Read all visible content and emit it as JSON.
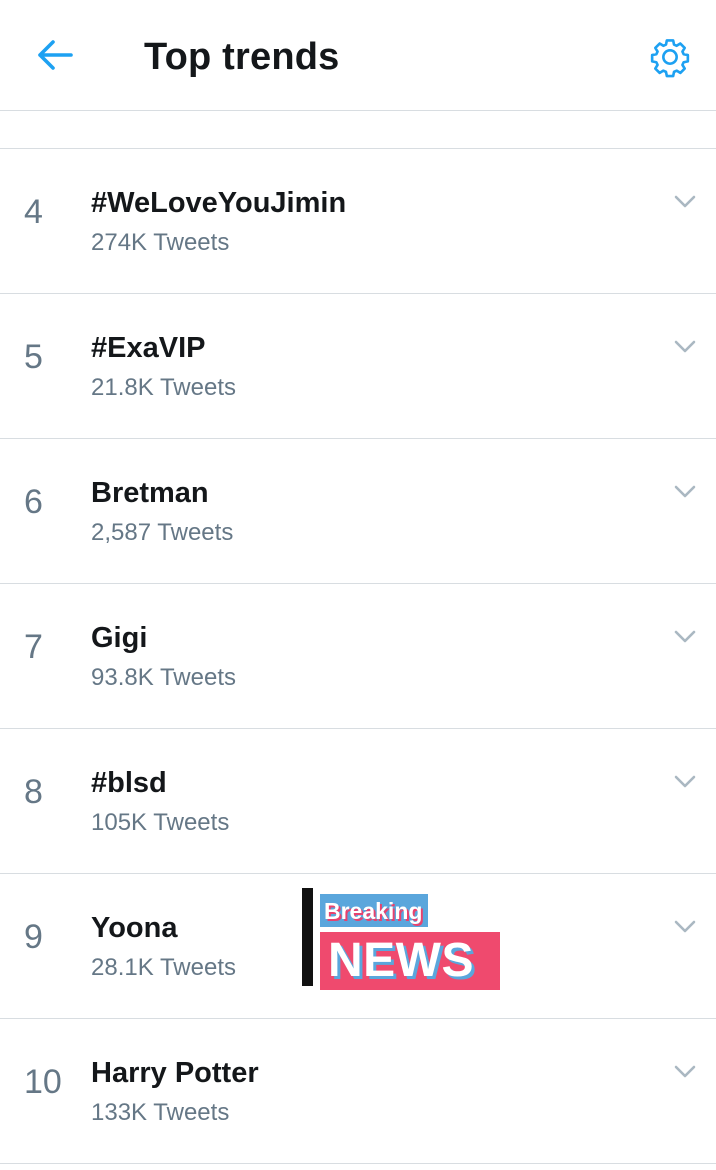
{
  "header": {
    "title": "Top trends"
  },
  "trends": [
    {
      "rank": "4",
      "name": "#WeLoveYouJimin",
      "count": "274K Tweets"
    },
    {
      "rank": "5",
      "name": "#ExaVIP",
      "count": "21.8K Tweets"
    },
    {
      "rank": "6",
      "name": "Bretman",
      "count": "2,587 Tweets"
    },
    {
      "rank": "7",
      "name": "Gigi",
      "count": "93.8K Tweets"
    },
    {
      "rank": "8",
      "name": "#blsd",
      "count": "105K Tweets"
    },
    {
      "rank": "9",
      "name": "Yoona",
      "count": "28.1K Tweets"
    },
    {
      "rank": "10",
      "name": "Harry Potter",
      "count": "133K Tweets"
    }
  ],
  "overlay": {
    "line1": "Breaking",
    "line2": "NEWS"
  },
  "icons": {
    "back": "arrow-left-icon",
    "settings": "gear-icon",
    "expand": "chevron-down-icon"
  },
  "colors": {
    "accent": "#1da1f2",
    "secondary_text": "#657786",
    "divider": "#d8dde1"
  }
}
